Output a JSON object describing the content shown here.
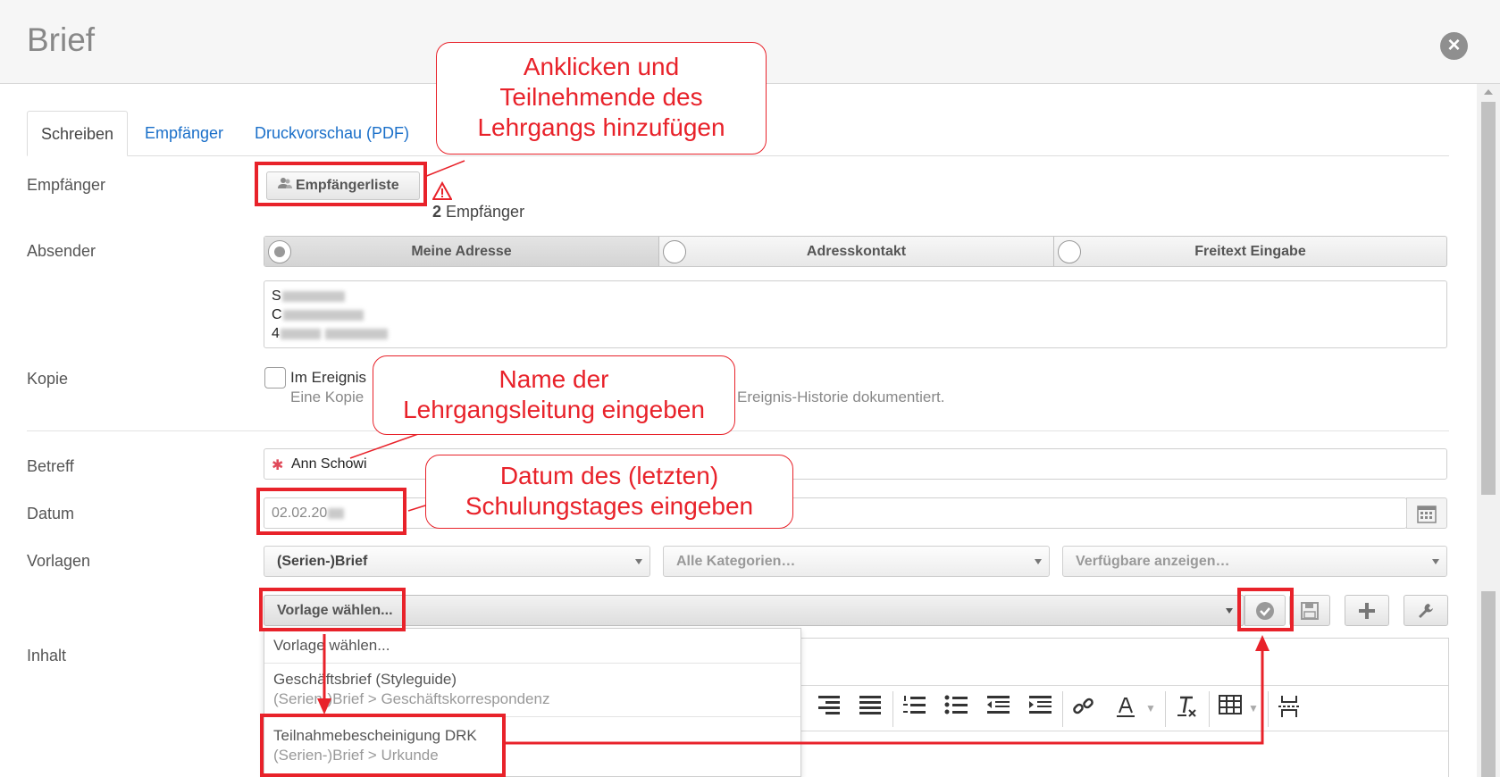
{
  "window": {
    "title": "Brief",
    "close_icon": "×"
  },
  "tabs": [
    {
      "label": "Schreiben"
    },
    {
      "label": "Empfänger"
    },
    {
      "label": "Druckvorschau (PDF)"
    }
  ],
  "form": {
    "recipients_label": "Empfänger",
    "recipients_button": "Empfängerliste",
    "recipients_count": "2",
    "recipients_count_suffix": " Empfänger",
    "sender_label": "Absender",
    "sender_options": [
      "Meine Adresse",
      "Adresskontakt",
      "Freitext Eingabe"
    ],
    "sender_selected": "Meine Adresse",
    "address_lines": [
      "S",
      "C",
      "4"
    ],
    "copy_label": "Kopie",
    "copy_checkbox_label": "Im Ereignis",
    "copy_hint_start": "Eine Kopie",
    "copy_hint_end": "Ereignis-Historie dokumentiert.",
    "subject_label": "Betreff",
    "subject_value": "Ann Schowi",
    "date_label": "Datum",
    "date_value": "02.02.20",
    "templates_label": "Vorlagen",
    "template_type": "(Serien-)Brief",
    "template_category": "Alle Kategorien…",
    "template_availability": "Verfügbare anzeigen…",
    "template_select": "Vorlage wählen...",
    "content_label": "Inhalt"
  },
  "dropdown_items": [
    {
      "main": "Vorlage wählen...",
      "sub": ""
    },
    {
      "main": "Geschäftsbrief (Styleguide)",
      "sub": "(Serien-)Brief > Geschäftskorrespondenz"
    },
    {
      "main": "Teilnahmebescheinigung DRK",
      "sub": "(Serien-)Brief > Urkunde"
    }
  ],
  "annotations": {
    "bubble1": [
      "Anklicken und",
      "Teilnehmende des",
      "Lehrgangs hinzufügen"
    ],
    "bubble2": [
      "Name der",
      "Lehrgangsleitung eingeben"
    ],
    "bubble3": [
      "Datum des (letzten)",
      "Schulungstages eingeben"
    ]
  },
  "colors": {
    "annotation_red": "#e8222a",
    "link_blue": "#1a6fc9"
  }
}
